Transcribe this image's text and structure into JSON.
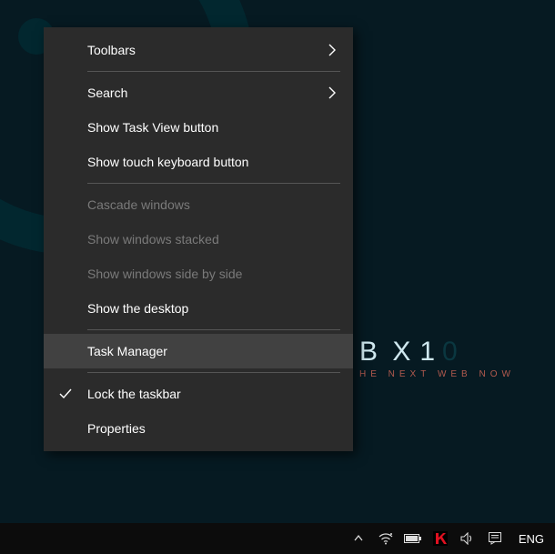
{
  "desktop": {
    "brand_name": "B X",
    "brand_digits_light": "1",
    "brand_digits_dark": "0",
    "brand_tagline": "HE NEXT WEB NOW"
  },
  "context_menu": {
    "groups": [
      {
        "items": [
          {
            "id": "toolbars",
            "label": "Toolbars",
            "has_submenu": true,
            "enabled": true,
            "checked": false,
            "highlighted": false
          }
        ]
      },
      {
        "items": [
          {
            "id": "search",
            "label": "Search",
            "has_submenu": true,
            "enabled": true,
            "checked": false,
            "highlighted": false
          },
          {
            "id": "task-view-btn",
            "label": "Show Task View button",
            "has_submenu": false,
            "enabled": true,
            "checked": false,
            "highlighted": false
          },
          {
            "id": "touch-kb-btn",
            "label": "Show touch keyboard button",
            "has_submenu": false,
            "enabled": true,
            "checked": false,
            "highlighted": false
          }
        ]
      },
      {
        "items": [
          {
            "id": "cascade",
            "label": "Cascade windows",
            "has_submenu": false,
            "enabled": false,
            "checked": false,
            "highlighted": false
          },
          {
            "id": "stacked",
            "label": "Show windows stacked",
            "has_submenu": false,
            "enabled": false,
            "checked": false,
            "highlighted": false
          },
          {
            "id": "sidebyside",
            "label": "Show windows side by side",
            "has_submenu": false,
            "enabled": false,
            "checked": false,
            "highlighted": false
          },
          {
            "id": "show-desk",
            "label": "Show the desktop",
            "has_submenu": false,
            "enabled": true,
            "checked": false,
            "highlighted": false
          }
        ]
      },
      {
        "items": [
          {
            "id": "task-mgr",
            "label": "Task Manager",
            "has_submenu": false,
            "enabled": true,
            "checked": false,
            "highlighted": true
          }
        ]
      },
      {
        "items": [
          {
            "id": "lock-tb",
            "label": "Lock the taskbar",
            "has_submenu": false,
            "enabled": true,
            "checked": true,
            "highlighted": false
          },
          {
            "id": "properties",
            "label": "Properties",
            "has_submenu": false,
            "enabled": true,
            "checked": false,
            "highlighted": false
          }
        ]
      }
    ]
  },
  "taskbar": {
    "tray_icons": [
      {
        "id": "overflow",
        "name": "tray-overflow-icon"
      },
      {
        "id": "network",
        "name": "network-icon"
      },
      {
        "id": "battery",
        "name": "battery-icon"
      },
      {
        "id": "kaspersky",
        "name": "kaspersky-icon"
      },
      {
        "id": "volume",
        "name": "volume-icon"
      },
      {
        "id": "action-center",
        "name": "action-center-icon"
      }
    ],
    "language": "ENG"
  }
}
